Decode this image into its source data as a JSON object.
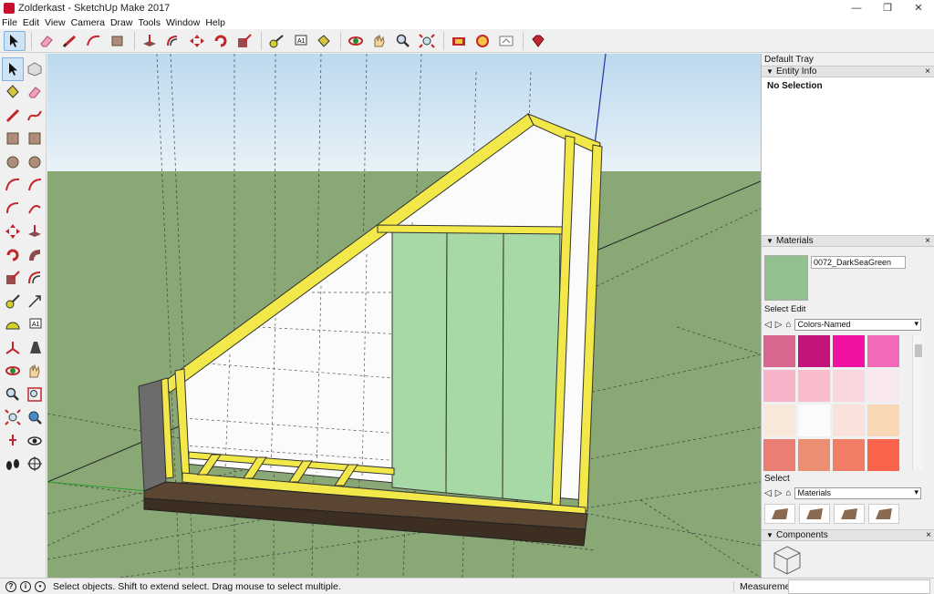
{
  "window": {
    "title": "Zolderkast - SketchUp Make 2017",
    "controls": [
      "—",
      "❐",
      "✕"
    ]
  },
  "menu": [
    "File",
    "Edit",
    "View",
    "Camera",
    "Draw",
    "Tools",
    "Window",
    "Help"
  ],
  "toolbar": [
    {
      "icon": "select-arrow-icon",
      "active": true
    },
    {
      "icon": "eraser-icon"
    },
    {
      "icon": "pencil-line-icon"
    },
    {
      "icon": "arc-icon"
    },
    {
      "icon": "rectangle-icon"
    },
    {
      "icon": "push-pull-icon"
    },
    {
      "icon": "offset-icon"
    },
    {
      "icon": "move-icon"
    },
    {
      "icon": "rotate-icon"
    },
    {
      "icon": "scale-icon"
    },
    {
      "icon": "tape-measure-icon"
    },
    {
      "icon": "text-icon"
    },
    {
      "icon": "paint-bucket-icon"
    },
    {
      "icon": "orbit-icon"
    },
    {
      "icon": "pan-hand-icon"
    },
    {
      "icon": "zoom-icon"
    },
    {
      "icon": "zoom-extents-icon"
    },
    {
      "icon": "warehouse-icon"
    },
    {
      "icon": "extension-icon"
    },
    {
      "icon": "share-model-icon"
    },
    {
      "icon": "ruby-icon"
    }
  ],
  "left_tools": [
    "select-arrow-icon",
    "make-component-icon",
    "paint-bucket-icon",
    "eraser-icon",
    "pencil-line-icon",
    "freehand-icon",
    "rectangle-icon",
    "rotated-rectangle-icon",
    "circle-icon",
    "polygon-icon",
    "arc-icon",
    "pie-icon",
    "two-point-arc-icon",
    "three-point-arc-icon",
    "move-icon",
    "push-pull-icon",
    "rotate-icon",
    "follow-me-icon",
    "scale-icon",
    "offset-icon",
    "tape-measure-icon",
    "dimension-icon",
    "protractor-icon",
    "text-icon",
    "axes-icon",
    "3d-text-icon",
    "orbit-icon",
    "pan-hand-icon",
    "zoom-icon",
    "zoom-window-icon",
    "zoom-extents-icon",
    "previous-view-icon",
    "position-camera-icon",
    "look-around-icon",
    "walk-icon",
    "section-plane-icon"
  ],
  "tray": {
    "title": "Default Tray",
    "entity_info": {
      "header": "Entity Info",
      "selection": "No Selection"
    },
    "materials": {
      "header": "Materials",
      "material_name": "0072_DarkSeaGreen",
      "preview_color": "#93c08f",
      "tabs": "Select  Edit",
      "library": "Colors-Named",
      "swatches": [
        "#d9668e",
        "#c2147a",
        "#f012a0",
        "#f26ab8",
        "#f7b3c7",
        "#f8bcca",
        "#f8d8dc",
        "#f8e8ee",
        "#f8e8da",
        "#fbfbfb",
        "#f9e2dc",
        "#f9d9b5",
        "#ec7f74",
        "#ec8e72",
        "#f17d66",
        "#f9634a"
      ],
      "select_label": "Select",
      "secondary_library": "Materials"
    },
    "components": {
      "header": "Components"
    }
  },
  "status": {
    "hint": "Select objects. Shift to extend select. Drag mouse to select multiple.",
    "measurements_label": "Measurements"
  }
}
